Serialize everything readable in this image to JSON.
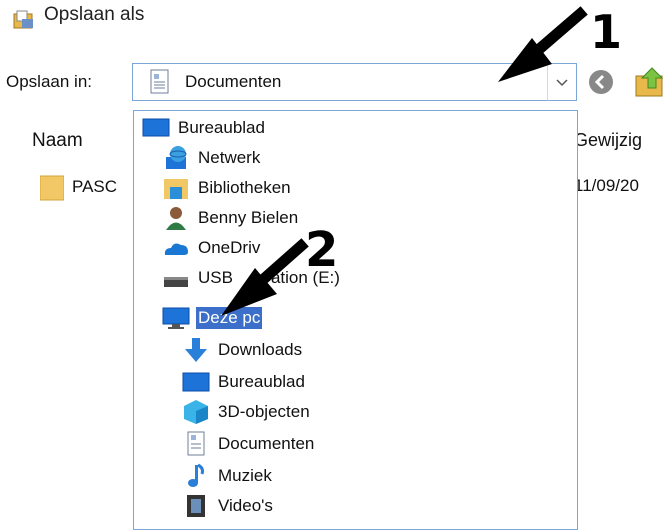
{
  "window": {
    "title": "Opslaan als"
  },
  "save_in": {
    "label": "Opslaan in:",
    "selected": "Documenten"
  },
  "columns": {
    "name": "Naam",
    "modified": "Gewijzig"
  },
  "files": [
    {
      "name": "PASC",
      "modified": "11/09/20"
    }
  ],
  "dropdown": {
    "items": [
      {
        "label": "Bureaublad",
        "icon": "desktop-icon"
      },
      {
        "label": "Netwerk",
        "icon": "network-icon"
      },
      {
        "label": "Bibliotheken",
        "icon": "libraries-icon"
      },
      {
        "label": "Benny Bielen",
        "icon": "user-icon"
      },
      {
        "label": "OneDriv",
        "icon": "onedrive-icon"
      },
      {
        "label": "USB",
        "label_suffix": "ation (E:)",
        "icon": "usb-drive-icon"
      },
      {
        "label": "Deze pc",
        "icon": "this-pc-icon",
        "selected": true
      },
      {
        "label": "Downloads",
        "icon": "downloads-icon"
      },
      {
        "label": "Bureaublad",
        "icon": "desktop-icon"
      },
      {
        "label": "3D-objecten",
        "icon": "3d-objects-icon"
      },
      {
        "label": "Documenten",
        "icon": "documents-icon"
      },
      {
        "label": "Muziek",
        "icon": "music-icon"
      },
      {
        "label": "Video's",
        "icon": "videos-icon"
      }
    ]
  },
  "annotations": {
    "marker1": "1",
    "marker2": "2"
  },
  "colors": {
    "selection": "#3b6fc9",
    "border": "#7aa7d8"
  }
}
